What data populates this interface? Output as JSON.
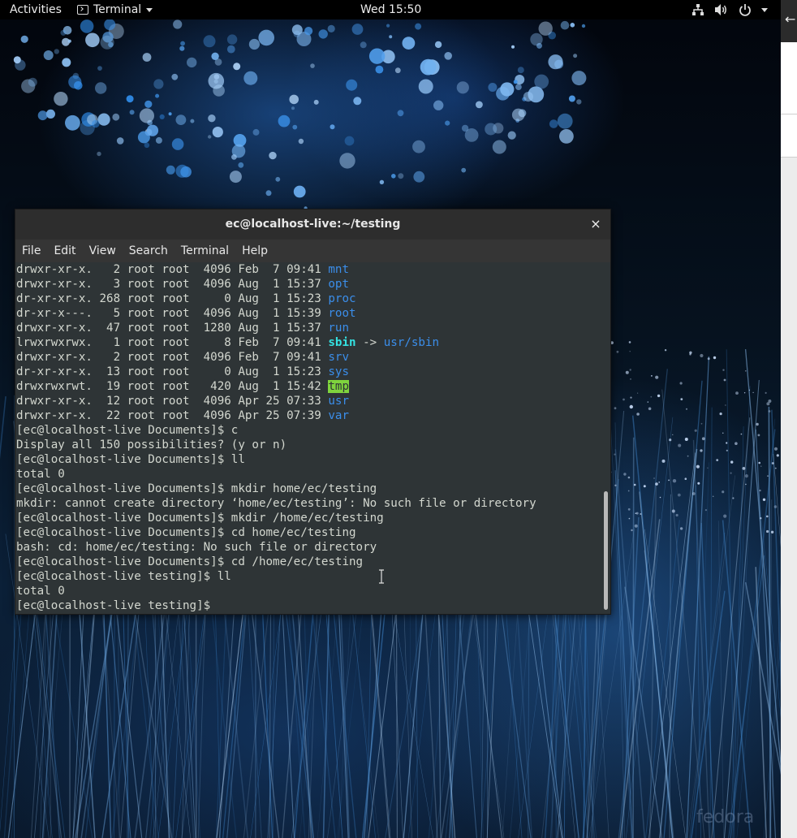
{
  "topbar": {
    "activities": "Activities",
    "app_name": "Terminal",
    "clock": "Wed 15:50"
  },
  "window": {
    "title": "ec@localhost-live:~/testing",
    "close": "×"
  },
  "menu": [
    "File",
    "Edit",
    "View",
    "Search",
    "Terminal",
    "Help"
  ],
  "terminal": {
    "lines": [
      {
        "pre": "drwxr-xr-x.   2 root root  4096 Feb  7 09:41 ",
        "name": "mnt",
        "cls": "blue"
      },
      {
        "pre": "drwxr-xr-x.   3 root root  4096 Aug  1 15:37 ",
        "name": "opt",
        "cls": "blue"
      },
      {
        "pre": "dr-xr-xr-x. 268 root root     0 Aug  1 15:23 ",
        "name": "proc",
        "cls": "blue"
      },
      {
        "pre": "dr-xr-x---.   5 root root  4096 Aug  1 15:39 ",
        "name": "root",
        "cls": "blue"
      },
      {
        "pre": "drwxr-xr-x.  47 root root  1280 Aug  1 15:37 ",
        "name": "run",
        "cls": "blue"
      },
      {
        "pre": "lrwxrwxrwx.   1 root root     8 Feb  7 09:41 ",
        "name": "sbin",
        "cls": "cyan",
        "post": " -> ",
        "target": "usr/sbin"
      },
      {
        "pre": "drwxr-xr-x.   2 root root  4096 Feb  7 09:41 ",
        "name": "srv",
        "cls": "blue"
      },
      {
        "pre": "dr-xr-xr-x.  13 root root     0 Aug  1 15:23 ",
        "name": "sys",
        "cls": "blue"
      },
      {
        "pre": "drwxrwxrwt.  19 root root   420 Aug  1 15:42 ",
        "name": "tmp",
        "cls": "hl"
      },
      {
        "pre": "drwxr-xr-x.  12 root root  4096 Apr 25 07:33 ",
        "name": "usr",
        "cls": "blue"
      },
      {
        "pre": "drwxr-xr-x.  22 root root  4096 Apr 25 07:39 ",
        "name": "var",
        "cls": "blue"
      },
      {
        "pre": "[ec@localhost-live Documents]$ c"
      },
      {
        "pre": "Display all 150 possibilities? (y or n)"
      },
      {
        "pre": "[ec@localhost-live Documents]$ ll"
      },
      {
        "pre": "total 0"
      },
      {
        "pre": "[ec@localhost-live Documents]$ mkdir home/ec/testing"
      },
      {
        "pre": "mkdir: cannot create directory ‘home/ec/testing’: No such file or directory"
      },
      {
        "pre": "[ec@localhost-live Documents]$ mkdir /home/ec/testing"
      },
      {
        "pre": "[ec@localhost-live Documents]$ cd home/ec/testing"
      },
      {
        "pre": "bash: cd: home/ec/testing: No such file or directory"
      },
      {
        "pre": "[ec@localhost-live Documents]$ cd /home/ec/testing"
      },
      {
        "pre": "[ec@localhost-live testing]$ ll"
      },
      {
        "pre": "total 0"
      },
      {
        "pre": "[ec@localhost-live testing]$ "
      }
    ]
  },
  "watermark": "fedora",
  "icons": {
    "terminal": "terminal-icon",
    "network": "network-icon",
    "volume": "volume-icon",
    "power": "power-icon",
    "back": "back-arrow-icon"
  }
}
